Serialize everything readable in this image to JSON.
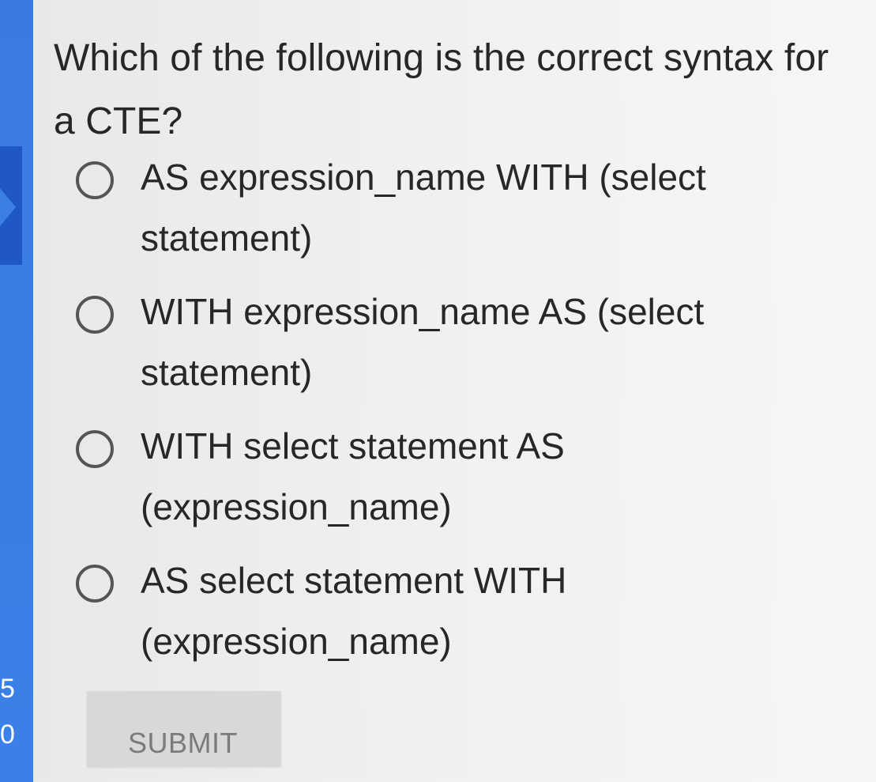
{
  "question": {
    "text": "Which of the following is the correct syntax for a CTE?"
  },
  "options": [
    {
      "label": "AS expression_name WITH (select statement)"
    },
    {
      "label": "WITH expression_name AS (select statement)"
    },
    {
      "label": "WITH select statement AS (expression_name)"
    },
    {
      "label": "AS select statement WITH (expression_name)"
    }
  ],
  "submit": {
    "label": "SUBMIT"
  },
  "side_panel": {
    "digit_top": "5",
    "digit_bottom": "0"
  },
  "colors": {
    "accent_blue": "#3A7BE0",
    "dark_blue": "#1F58C4",
    "text": "#272727",
    "disabled_button": "#D8D8D6"
  },
  "icons": {
    "radio": "radio-unchecked-icon"
  }
}
